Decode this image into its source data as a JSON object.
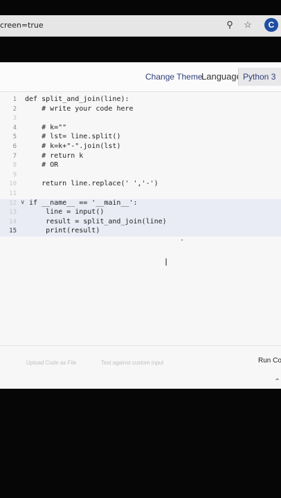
{
  "browser": {
    "url_fragment": "creen=true",
    "icons": [
      "zoom-icon",
      "star-add-icon"
    ],
    "profile_letter": "C"
  },
  "toolbar": {
    "change_theme": "Change Theme",
    "language_label": "Language",
    "language_value": "Python 3"
  },
  "code_lines": [
    {
      "n": "1",
      "text": "def split_and_join(line):"
    },
    {
      "n": "2",
      "text": "    # write your code here"
    },
    {
      "n": "3",
      "text": ""
    },
    {
      "n": "4",
      "text": "    # k=\"\""
    },
    {
      "n": "5",
      "text": "    # lst= line.split()"
    },
    {
      "n": "6",
      "text": "    # k=k+\"-\".join(lst)"
    },
    {
      "n": "7",
      "text": "    # return k"
    },
    {
      "n": "8",
      "text": "    # OR"
    },
    {
      "n": "9",
      "text": ""
    },
    {
      "n": "10",
      "text": "    return line.replace(' ','-')"
    },
    {
      "n": "11",
      "text": ""
    },
    {
      "n": "12",
      "text": "if __name__ == '__main__':"
    },
    {
      "n": "13",
      "text": "    line = input()"
    },
    {
      "n": "14",
      "text": "    result = split_and_join(line)"
    },
    {
      "n": "15",
      "text": "    print(result)"
    }
  ],
  "footer": {
    "upload_label": "Upload Code as File",
    "test_label": "Test against custom input",
    "run_label": "Run Co"
  }
}
